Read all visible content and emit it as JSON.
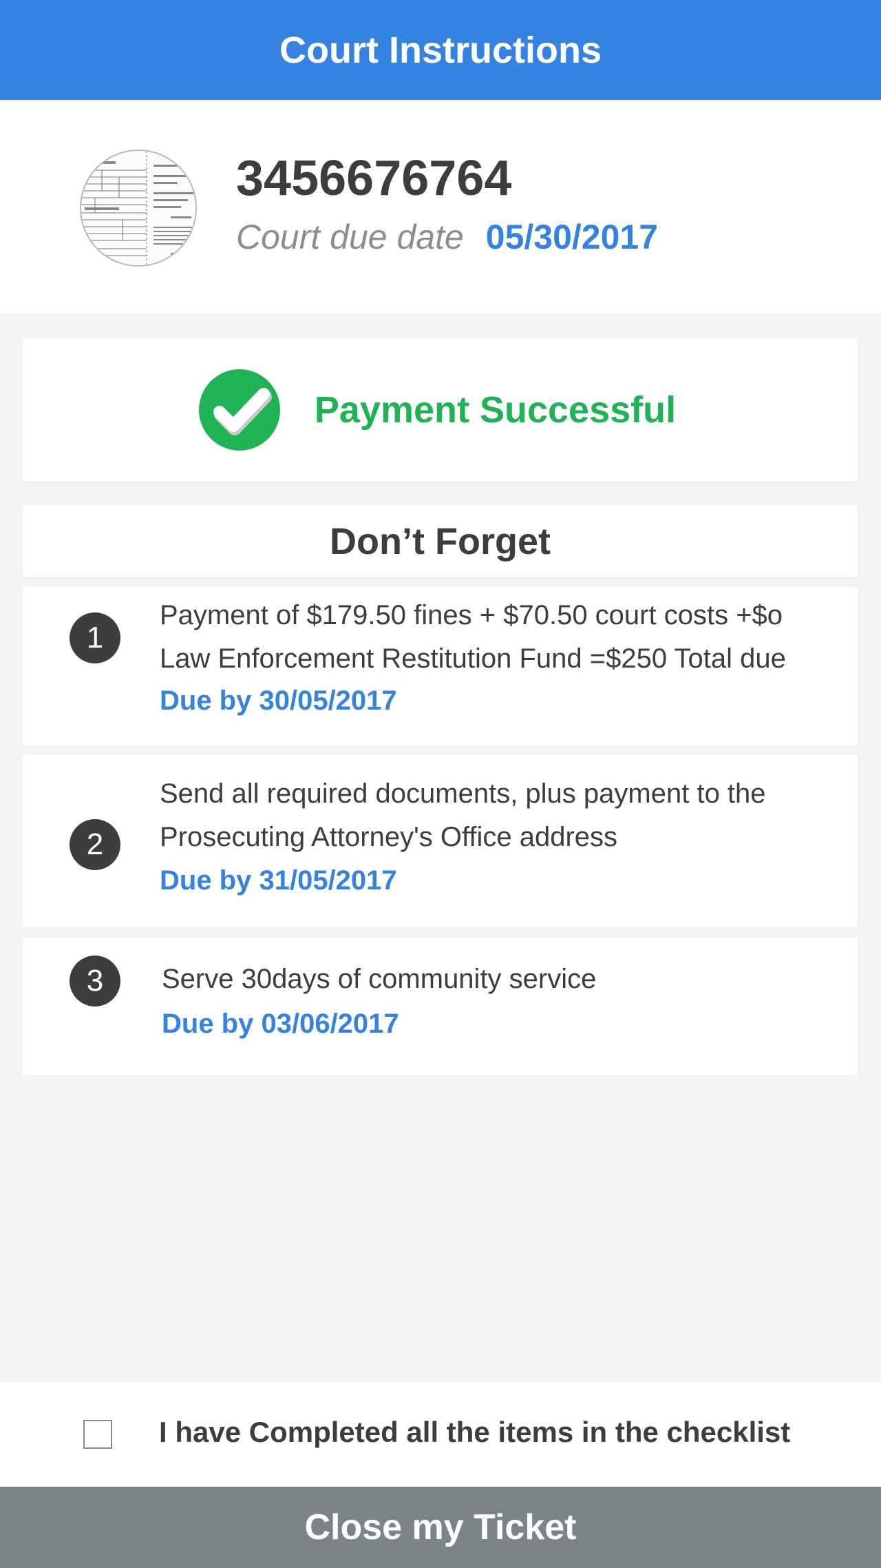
{
  "header": {
    "title": "Court Instructions"
  },
  "ticket": {
    "number": "3456676764",
    "due_label": "Court due date",
    "due_date": "05/30/2017",
    "thumbnail_icon": "ticket-document-thumbnail"
  },
  "payment_status": {
    "icon": "check-circle-icon",
    "text": "Payment Successful",
    "color": "#1fb355"
  },
  "dont_forget": {
    "title": "Don’t Forget",
    "items": [
      {
        "number": "1",
        "line1": "Payment of $179.50 fines + $70.50 court costs +$o",
        "line2": "Law Enforcement Restitution Fund =$250 Total due",
        "due": "Due by 30/05/2017"
      },
      {
        "number": "2",
        "line1": "Send all required documents, plus payment to the",
        "line2": "Prosecuting Attorney's Office address",
        "due": "Due by 31/05/2017"
      },
      {
        "number": "3",
        "line1": "Serve 30days of community service",
        "due": "Due by 03/06/2017"
      }
    ]
  },
  "checklist": {
    "label": "I have Completed all the items in the checklist",
    "checked": false
  },
  "footer": {
    "close_label": "Close my Ticket"
  },
  "colors": {
    "accent": "#3483e0",
    "success": "#1fb355",
    "button": "#7b8487",
    "text": "#3d3c3f"
  }
}
